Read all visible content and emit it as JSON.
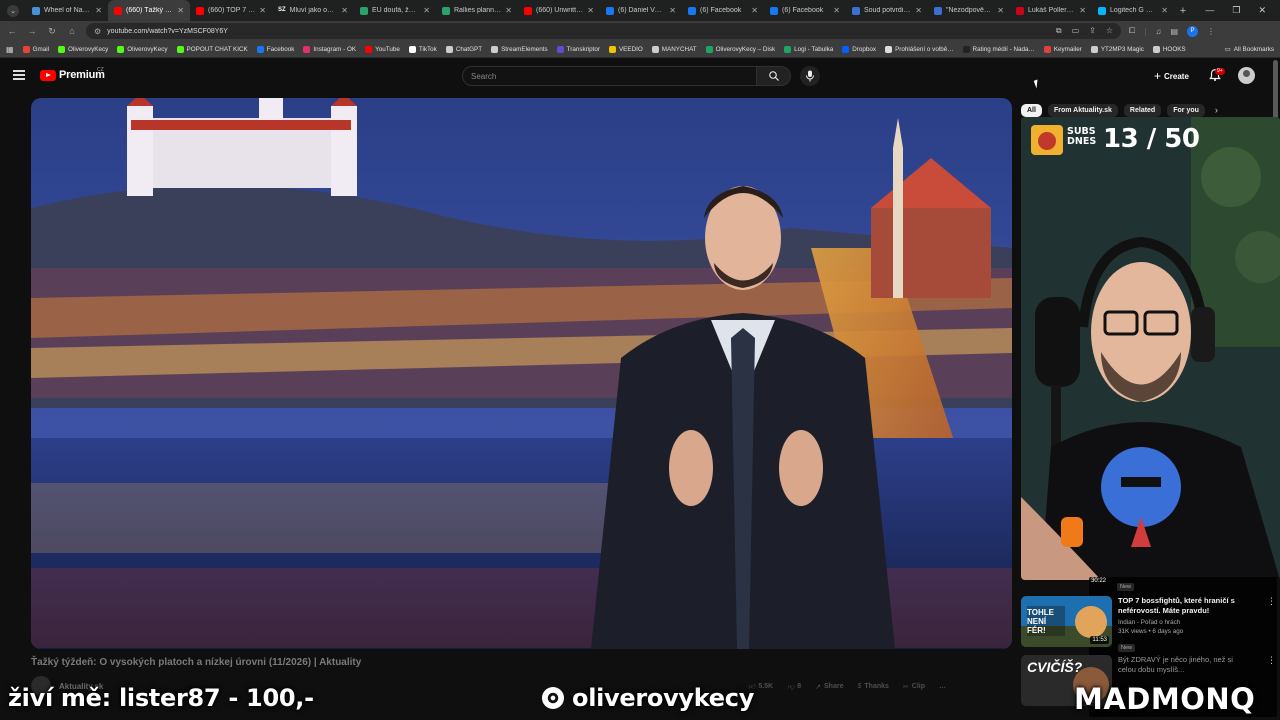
{
  "browser": {
    "tabs": [
      {
        "title": "Wheel of Names",
        "color": "#4a90d9",
        "active": false
      },
      {
        "title": "(660) Ťažký týždeň",
        "color": "#ff0000",
        "active": true
      },
      {
        "title": "(660) TOP 7 her z",
        "color": "#ff0000",
        "active": false
      },
      {
        "title": "Mluví jako on, dě",
        "color": "#ffffff",
        "icon_text": "SZ",
        "active": false
      },
      {
        "title": "EU doufá, že ma",
        "color": "#2aa36b",
        "active": false
      },
      {
        "title": "Rallies planned in",
        "color": "#2aa36b",
        "active": false
      },
      {
        "title": "(660) Unwritten",
        "color": "#ff0000",
        "active": false
      },
      {
        "title": "(6) Daniel Vavra",
        "color": "#1877f2",
        "active": false
      },
      {
        "title": "(6) Facebook",
        "color": "#1877f2",
        "active": false
      },
      {
        "title": "(6) Facebook",
        "color": "#1877f2",
        "active": false
      },
      {
        "title": "Soud potvrdil po",
        "color": "#3b6fd4",
        "active": false
      },
      {
        "title": "\"Nezodpovědný",
        "color": "#3b6fd4",
        "active": false
      },
      {
        "title": "Lukáš Pollert, oč",
        "color": "#d0021b",
        "active": false
      },
      {
        "title": "Logitech G PRO",
        "color": "#00b8fc",
        "active": false
      }
    ],
    "url": "youtube.com/watch?v=YzMSCF08Y6Y",
    "profile_letter": "P",
    "bookmarks": [
      {
        "label": "Gmail",
        "color": "#ea4335"
      },
      {
        "label": "OliverovyKecy",
        "color": "#53fc18"
      },
      {
        "label": "OliverovyKecy",
        "color": "#53fc18"
      },
      {
        "label": "POPOUT CHAT KICK",
        "color": "#53fc18"
      },
      {
        "label": "Facebook",
        "color": "#1877f2"
      },
      {
        "label": "Instagram - OK",
        "color": "#e1306c"
      },
      {
        "label": "YouTube",
        "color": "#ff0000"
      },
      {
        "label": "TikTok",
        "color": "#ffffff"
      },
      {
        "label": "ChatGPT",
        "color": "#cccccc"
      },
      {
        "label": "StreamElements",
        "color": "#cccccc"
      },
      {
        "label": "Transkriptor",
        "color": "#5a4fcf"
      },
      {
        "label": "VEEDIO",
        "color": "#f5c400"
      },
      {
        "label": "MANYCHAT",
        "color": "#cccccc"
      },
      {
        "label": "OliverovyKecy – Disk",
        "color": "#1fa463"
      },
      {
        "label": "Logi - Tabulka",
        "color": "#1fa463"
      },
      {
        "label": "Dropbox",
        "color": "#0061ff"
      },
      {
        "label": "Prohlášení o volbě…",
        "color": "#dddddd"
      },
      {
        "label": "Rating médií - Nada…",
        "color": "#222222"
      },
      {
        "label": "Keymailer",
        "color": "#e04040"
      },
      {
        "label": "YT2MP3 Magic",
        "color": "#cccccc"
      },
      {
        "label": "HOOKS",
        "color": "#cccccc"
      }
    ],
    "all_bookmarks_label": "All Bookmarks"
  },
  "youtube": {
    "logo_text": "Premium",
    "region": "CZ",
    "search_placeholder": "Search",
    "create_label": "Create",
    "notif_count": "9+",
    "video_title": "Ťažký týždeň: O vysokých platoch a nízkej úrovni (11/2026) | Aktuality",
    "channel_name": "Aktuality.sk",
    "actions": [
      "5.5K",
      "8",
      "Share",
      "Thanks",
      "Clip",
      "…"
    ],
    "chips": [
      {
        "label": "All",
        "active": true
      },
      {
        "label": "From Aktuality.sk",
        "active": false
      },
      {
        "label": "Related",
        "active": false
      },
      {
        "label": "For you",
        "active": false
      }
    ],
    "recommendations": [
      {
        "title": "TOP 7 bossfightů, které hraničí s neférovostí. Máte pravdu!",
        "channel": "Indian - Pořad o hrách",
        "views": "31K views • 6 days ago",
        "badge": "New",
        "duration": "11:53",
        "thumb_text": "TOHLE NENÍ FÉR!"
      },
      {
        "title": "Být ZDRAVÝ je něco jiného, než si celou dobu myslíš...",
        "channel": "",
        "views": "",
        "badge": "",
        "duration": "",
        "thumb_text": "CVIČÍŠ?"
      }
    ],
    "top_badge": "New",
    "top_duration": "30:22"
  },
  "stream": {
    "subs_label_line1": "SUBS",
    "subs_label_line2": "DNES",
    "subs_count": "13 / 50",
    "overlay_left": "živí mě: lister87 - 100,-",
    "overlay_handle": "oliverovykecy",
    "overlay_brand": "MADMONQ"
  }
}
